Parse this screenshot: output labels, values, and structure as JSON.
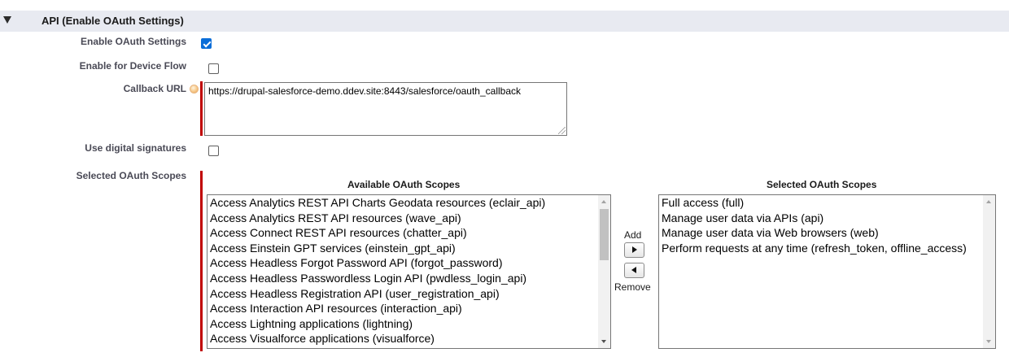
{
  "section": {
    "title": "API (Enable OAuth Settings)",
    "toggle_icon": "triangle-down-icon"
  },
  "fields": {
    "enable_oauth": {
      "label": "Enable OAuth Settings",
      "checked": true
    },
    "device_flow": {
      "label": "Enable for Device Flow",
      "checked": false
    },
    "callback_url": {
      "label": "Callback URL",
      "value": "https://drupal-salesforce-demo.ddev.site:8443/salesforce/oauth_callback",
      "required": true
    },
    "digital_signatures": {
      "label": "Use digital signatures",
      "checked": false
    },
    "scopes": {
      "label": "Selected OAuth Scopes",
      "required": true
    }
  },
  "available_scopes": {
    "title": "Available OAuth Scopes",
    "items": [
      "Access Analytics REST API Charts Geodata resources (eclair_api)",
      "Access Analytics REST API resources (wave_api)",
      "Access Connect REST API resources (chatter_api)",
      "Access Einstein GPT services (einstein_gpt_api)",
      "Access Headless Forgot Password API (forgot_password)",
      "Access Headless Passwordless Login API (pwdless_login_api)",
      "Access Headless Registration API (user_registration_api)",
      "Access Interaction API resources (interaction_api)",
      "Access Lightning applications (lightning)",
      "Access Visualforce applications (visualforce)"
    ]
  },
  "selected_scopes": {
    "title": "Selected OAuth Scopes",
    "items": [
      "Full access (full)",
      "Manage user data via APIs (api)",
      "Manage user data via Web browsers (web)",
      "Perform requests at any time (refresh_token, offline_access)"
    ]
  },
  "buttons": {
    "add_label": "Add",
    "remove_label": "Remove",
    "add_icon": "arrow-right-icon",
    "remove_icon": "arrow-left-icon"
  },
  "colors": {
    "checkbox_checked": "#0b6ed8",
    "required_indicator": "#c00000",
    "section_background": "#e8eaf1"
  }
}
